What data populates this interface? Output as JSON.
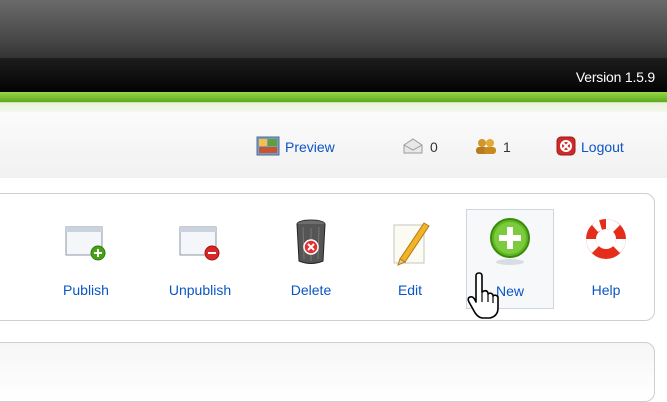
{
  "header": {
    "version_text": "Version 1.5.9",
    "accent": "#5aa518"
  },
  "status": {
    "preview_label": "Preview",
    "messages_count": "0",
    "users_count": "1",
    "logout_label": "Logout",
    "link_color": "#0b55c4"
  },
  "toolbar": {
    "items": [
      {
        "label": "Publish",
        "icon": "publish-icon"
      },
      {
        "label": "Unpublish",
        "icon": "unpublish-icon"
      },
      {
        "label": "Delete",
        "icon": "delete-icon"
      },
      {
        "label": "Edit",
        "icon": "edit-icon"
      },
      {
        "label": "New",
        "icon": "new-icon"
      },
      {
        "label": "Help",
        "icon": "help-icon"
      }
    ]
  }
}
